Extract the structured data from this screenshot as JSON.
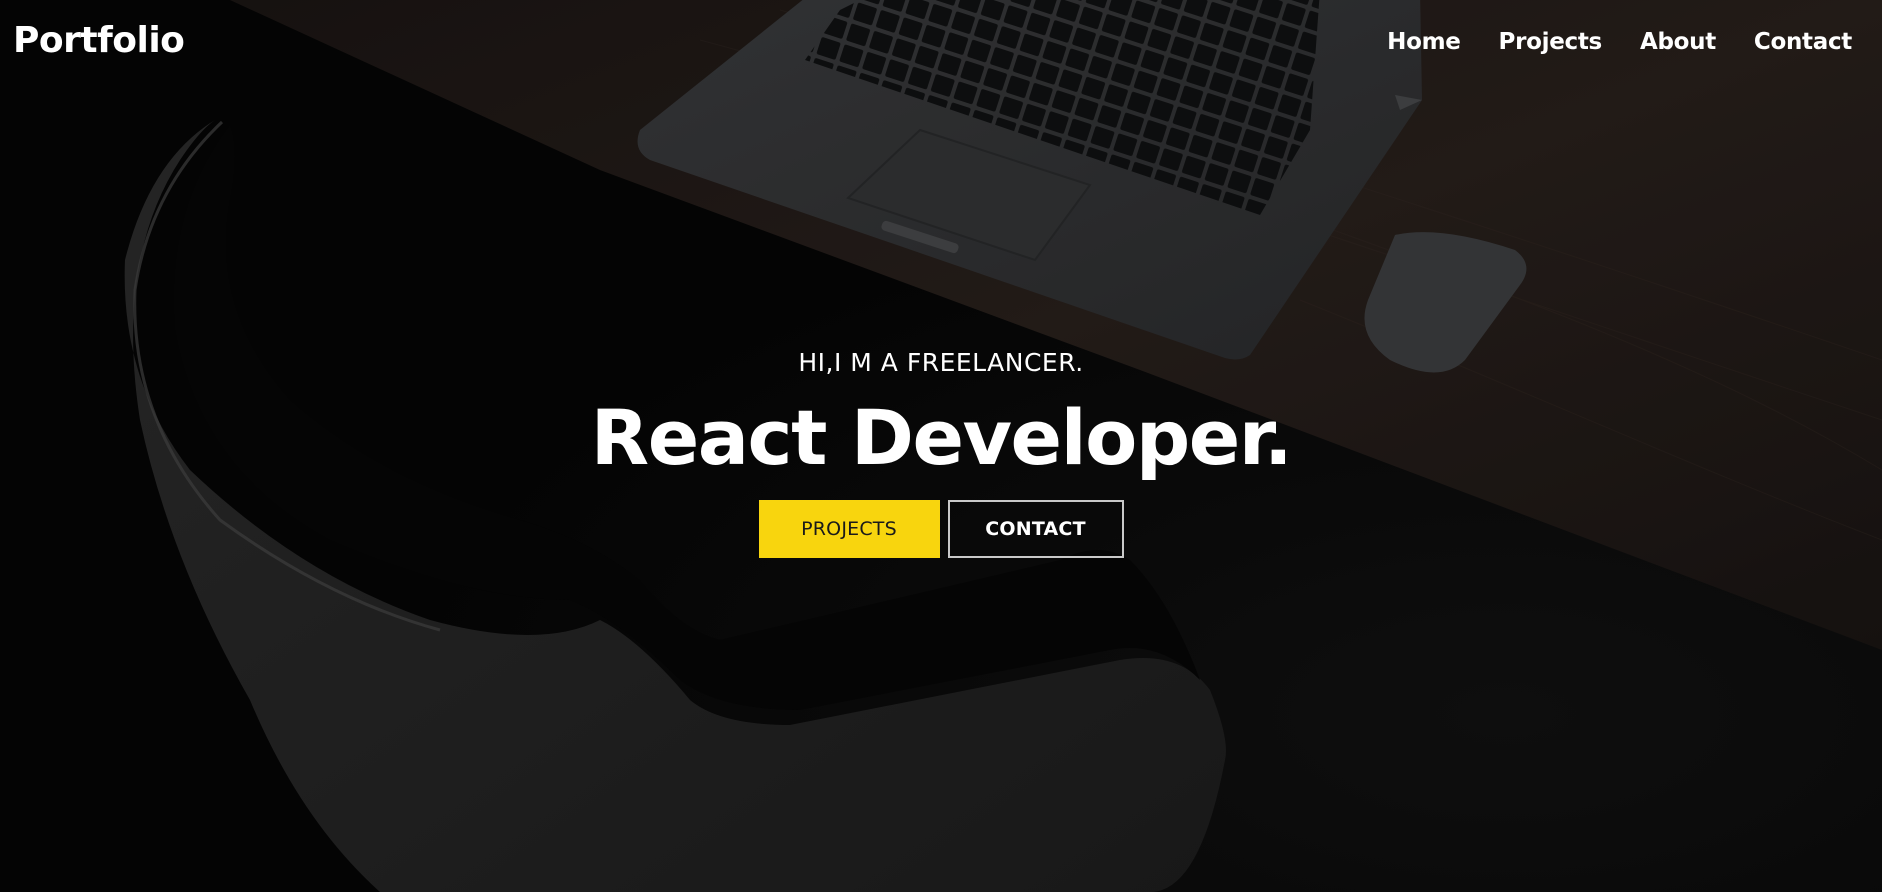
{
  "navbar": {
    "logo": "Portfolio",
    "links": [
      "Home",
      "Projects",
      "About",
      "Contact"
    ]
  },
  "hero": {
    "subtitle": "HI,I M A FREELANCER.",
    "title": "React Developer.",
    "buttons": {
      "projects": "PROJECTS",
      "contact": "CONTACT"
    }
  },
  "colors": {
    "accent": "#f8d50e",
    "text": "#ffffff",
    "background": "#050505"
  }
}
